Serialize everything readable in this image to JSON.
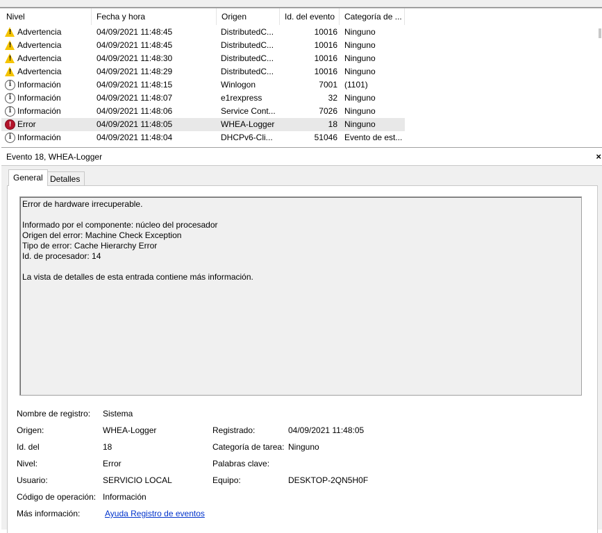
{
  "table": {
    "headers": {
      "level": "Nivel",
      "datetime": "Fecha y hora",
      "source": "Origen",
      "event_id": "Id. del evento",
      "category": "Categoría de ..."
    },
    "rows": [
      {
        "icon": "warning-icon",
        "level": "Advertencia",
        "datetime": "04/09/2021 11:48:45",
        "source": "DistributedC...",
        "event_id": "10016",
        "category": "Ninguno"
      },
      {
        "icon": "warning-icon",
        "level": "Advertencia",
        "datetime": "04/09/2021 11:48:45",
        "source": "DistributedC...",
        "event_id": "10016",
        "category": "Ninguno"
      },
      {
        "icon": "warning-icon",
        "level": "Advertencia",
        "datetime": "04/09/2021 11:48:30",
        "source": "DistributedC...",
        "event_id": "10016",
        "category": "Ninguno"
      },
      {
        "icon": "warning-icon",
        "level": "Advertencia",
        "datetime": "04/09/2021 11:48:29",
        "source": "DistributedC...",
        "event_id": "10016",
        "category": "Ninguno"
      },
      {
        "icon": "info-icon",
        "level": "Información",
        "datetime": "04/09/2021 11:48:15",
        "source": "Winlogon",
        "event_id": "7001",
        "category": "(1101)"
      },
      {
        "icon": "info-icon",
        "level": "Información",
        "datetime": "04/09/2021 11:48:07",
        "source": "e1rexpress",
        "event_id": "32",
        "category": "Ninguno"
      },
      {
        "icon": "info-icon",
        "level": "Información",
        "datetime": "04/09/2021 11:48:06",
        "source": "Service Cont...",
        "event_id": "7026",
        "category": "Ninguno"
      },
      {
        "icon": "error-icon",
        "level": "Error",
        "datetime": "04/09/2021 11:48:05",
        "source": "WHEA-Logger",
        "event_id": "18",
        "category": "Ninguno",
        "selected": true
      },
      {
        "icon": "info-icon",
        "level": "Información",
        "datetime": "04/09/2021 11:48:04",
        "source": "DHCPv6-Cli...",
        "event_id": "51046",
        "category": "Evento de est..."
      }
    ]
  },
  "detail": {
    "title": "Evento 18, WHEA-Logger",
    "close": "×",
    "tabs": [
      "General",
      "Detalles"
    ],
    "active_tab": "General",
    "message": {
      "line1": "Error de hardware irrecuperable.",
      "line2": "Informado por el componente: núcleo del procesador",
      "line3": "Origen del error: Machine Check Exception",
      "line4": "Tipo de error: Cache Hierarchy Error",
      "line5": "Id. de procesador: 14",
      "line6": "La vista de detalles de esta entrada contiene más información."
    },
    "props": {
      "log_name_label": "Nombre de registro:",
      "log_name": "Sistema",
      "source_label": "Origen:",
      "source": "WHEA-Logger",
      "logged_label": "Registrado:",
      "logged": "04/09/2021 11:48:05",
      "event_id_label": "Id. del",
      "event_id": "18",
      "task_category_label": "Categoría de tarea:",
      "task_category": "Ninguno",
      "level_label": "Nivel:",
      "level": "Error",
      "keywords_label": "Palabras clave:",
      "keywords": "",
      "user_label": "Usuario:",
      "user": "SERVICIO LOCAL",
      "computer_label": "Equipo:",
      "computer": "DESKTOP-2QN5H0F",
      "opcode_label": "Código de operación:",
      "opcode": "Información",
      "more_info_label": "Más información:",
      "more_info_link": "Ayuda Registro de eventos"
    }
  },
  "colors": {
    "warning": "#f5c400",
    "error": "#b3132a",
    "link": "#0033cc",
    "selected_row": "#e8e8e8"
  }
}
